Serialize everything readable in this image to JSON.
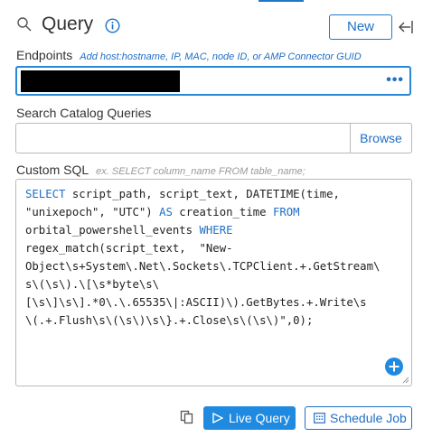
{
  "header": {
    "title": "Query",
    "new_label": "New"
  },
  "endpoints": {
    "label": "Endpoints",
    "hint": "Add host:hostname, IP, MAC, node ID, or AMP Connector GUID",
    "menu_glyph": "•••"
  },
  "catalog": {
    "label": "Search Catalog Queries",
    "value": "",
    "browse_label": "Browse"
  },
  "custom_sql": {
    "label": "Custom SQL",
    "placeholder": "ex. SELECT column_name FROM table_name;",
    "lines": [
      [
        {
          "t": "SELECT",
          "k": 1
        },
        {
          "t": " script_path, script_text, DATETIME(time,"
        }
      ],
      [
        {
          "t": "\"unixepoch\", \"UTC\") "
        },
        {
          "t": "AS",
          "k": 1
        },
        {
          "t": " creation_time "
        },
        {
          "t": "FROM",
          "k": 1
        }
      ],
      [
        {
          "t": "orbital_powershell_events "
        },
        {
          "t": "WHERE",
          "k": 1
        }
      ],
      [
        {
          "t": "regex_match(script_text,  \"New-"
        }
      ],
      [
        {
          "t": "Object\\s+System\\.Net\\.Sockets\\.TCPClient.+.GetStream\\"
        }
      ],
      [
        {
          "t": "s\\(\\s\\).\\[\\s*byte\\s\\"
        }
      ],
      [
        {
          "t": "[\\s\\]\\s\\].*0\\.\\.65535\\|:ASCII)\\).GetBytes.+.Write\\s"
        }
      ],
      [
        {
          "t": "\\(.+.Flush\\s\\(\\s\\)\\s\\}.+.Close\\s\\(\\s\\)\",0);"
        }
      ]
    ]
  },
  "footer": {
    "live_label": "Live Query",
    "schedule_label": "Schedule Job"
  },
  "colors": {
    "accent": "#1f6fc5",
    "primary_button": "#1f8ae0",
    "focus_border": "#2a86d6"
  }
}
